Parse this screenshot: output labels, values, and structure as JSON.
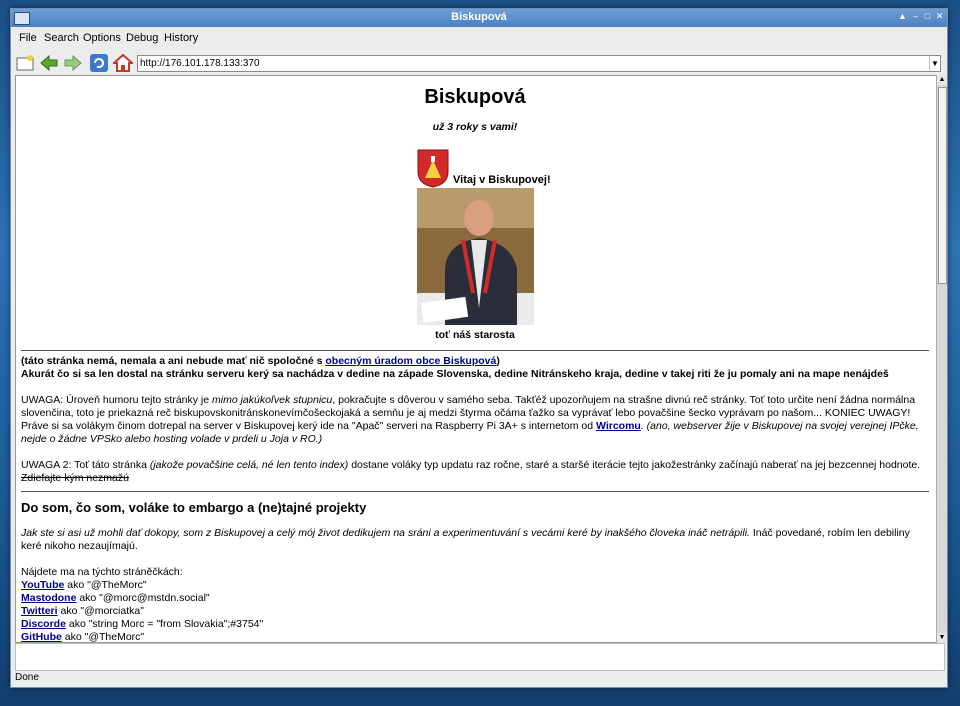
{
  "window": {
    "title": "Biskupová"
  },
  "menu": [
    "File",
    "Search",
    "Options",
    "Debug",
    "History"
  ],
  "toolbar": {
    "url": "http://176.101.178.133:370"
  },
  "page": {
    "heading": "Biskupová",
    "tagline": "už 3 roky s vami!",
    "welcome": "Vitaj v Biskupovej!",
    "caption": "toť náš starosta",
    "disclaimer_pre": "(táto stránka nemá, nemala a ani nebude mať nič spoločné s ",
    "disclaimer_link": "obecným úradom obce Biskupová",
    "disclaimer_post": ")",
    "server_line": "Akurát čo si sa len dostal na stránku serveru kerý sa nachádza v dedine na západe Slovenska, dedine Nitránskeho kraja, dedine v takej riti že ju pomaly ani na mape nenájdeš",
    "warning1_a": "UWAGA: Úroveň humoru tejto stránky je ",
    "warning1_b": "mimo jakúkoľvek stupnicu",
    "warning1_c": ", pokračujte s dôverou v samého seba. Takťéž upozorňujem na strašne divnú reč stránky. Toť toto určite není žádna normálna slovenčina, toto je priekazná reč biskupovskonitránskonevímčošeckojaká a semňu je aj medzi štyrma očáma ťažko sa vyprávať lebo povačšine šecko vyprávam po našom... KONIEC UWAGY!",
    "server2_a": "Práve si sa volákym činom dotrepal na server v Biskupovej kerý ide na \"Apač\" serveri na Raspberry Pi 3A+ s internetom od ",
    "server2_link": "Wircomu",
    "server2_b": ". (ano, webserver žije v Biskupovej na svojej verejnej IPčke, nejde o žádne VPSko alebo hosting volade v prdeli u Joja v RO.)",
    "warning2_a": "UWAGA 2: Toť táto stránka ",
    "warning2_b": "(jakože povačšine celá, né len tento index)",
    "warning2_c": " dostane voláky typ updatu raz ročne, staré a staršé iterácie tejto jakožestránky začínajú naberať na jej bezcennej hodnote. ",
    "warning2_strike": "Zdiefajte kým nezmažú",
    "section_heading": "Do som, čo som, voláke to embargo a (ne)tajné projekty",
    "intro_italic": "Jak ste si asi už mohli dať dokopy, som z Biskupovej a celý mój život dedikujem na sráni a experimentuvání s vecámi keré by inakšého človeka ináč netrápili.",
    "intro_plain": " Ináč povedané, robím len debiliny keré nikoho nezaujímajú.",
    "find_me": "Nájdete ma na týchto stráněčkách:",
    "links": [
      {
        "name": "YouTube",
        "text": " ako \"@TheMorc\""
      },
      {
        "name": "Mastodone",
        "text": " ako \"@morc@mstdn.social\""
      },
      {
        "name": "Twitteri",
        "text": " ako \"@morciatka\""
      },
      {
        "name": "Discorde",
        "text": " ako \"string Morc = \"from Slovakia\";#3754\""
      },
      {
        "name": "GitHube",
        "text": " ako \"@TheMorc\""
      }
    ]
  },
  "status": {
    "text": "Done"
  },
  "colors": {
    "link": "#00008b",
    "titlebar": "#4c7fbd"
  }
}
